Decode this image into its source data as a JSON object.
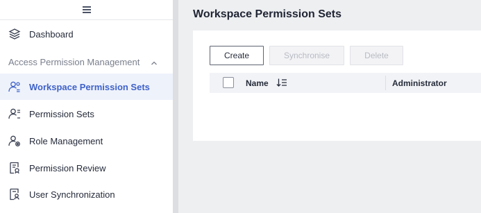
{
  "sidebar": {
    "items": [
      {
        "label": "Dashboard",
        "icon": "layers-icon"
      },
      {
        "label": "Workspace Permission Sets",
        "icon": "workspace-users-icon",
        "active": true
      },
      {
        "label": "Permission Sets",
        "icon": "user-list-icon"
      },
      {
        "label": "Role Management",
        "icon": "user-gear-icon"
      },
      {
        "label": "Permission Review",
        "icon": "document-review-icon"
      },
      {
        "label": "User Synchronization",
        "icon": "user-sync-icon"
      }
    ],
    "group": {
      "label": "Access Permission Management",
      "expanded": true
    }
  },
  "main": {
    "title": "Workspace Permission Sets",
    "toolbar": {
      "create_label": "Create",
      "synchronise_label": "Synchronise",
      "delete_label": "Delete"
    },
    "table": {
      "columns": [
        "Name",
        "Administrator"
      ],
      "rows": []
    }
  },
  "colors": {
    "accent": "#3f62c9",
    "active_bg": "#eef2fb",
    "page_bg": "#eeeff1",
    "disabled_text": "#b8bbc4"
  }
}
